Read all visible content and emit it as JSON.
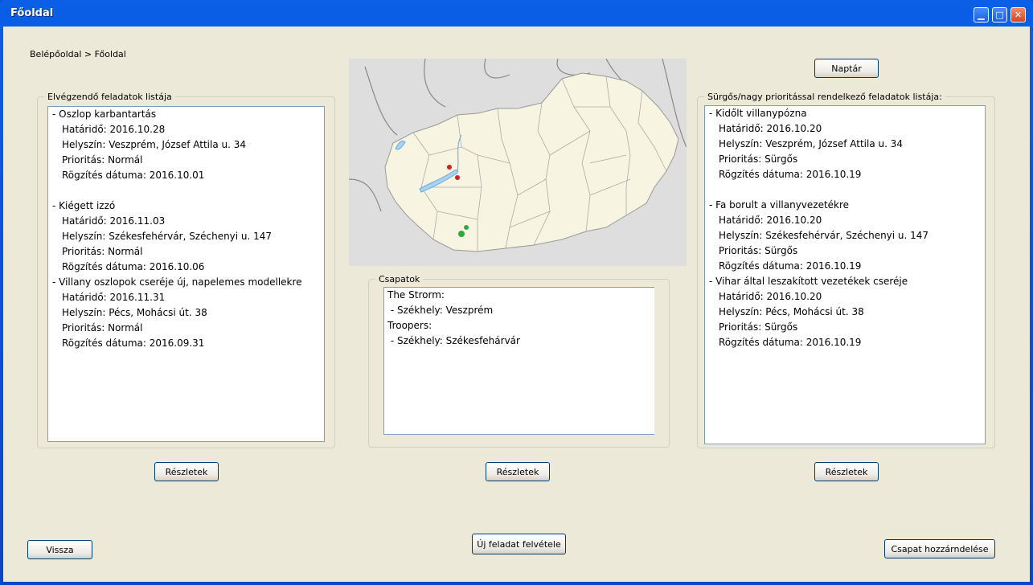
{
  "window": {
    "title": "Főoldal"
  },
  "breadcrumb": "Belépőoldal > Főoldal",
  "tasks_panel": {
    "legend": "Elvégzendő feladatok listája",
    "items": [
      {
        "title": "- Oszlop karbantartás",
        "deadline": "Határidő: 2016.10.28",
        "location": "Helyszín: Veszprém, József Attila u. 34",
        "priority": "Prioritás: Normál",
        "recorded": "Rögzítés dátuma: 2016.10.01"
      },
      {
        "title": "- Kiégett izzó",
        "deadline": "Határidő: 2016.11.03",
        "location": "Helyszín: Székesfehérvár, Széchenyi u. 147",
        "priority": "Prioritás: Normál",
        "recorded": "Rögzítés dátuma: 2016.10.06"
      },
      {
        "title": "- Villany oszlopok cseréje új, napelemes modellekre",
        "deadline": "Határidő: 2016.11.31",
        "location": "Helyszín: Pécs, Mohácsi út. 38",
        "priority": "Prioritás: Normál",
        "recorded": "Rögzítés dátuma: 2016.09.31"
      }
    ],
    "details_button": "Részletek"
  },
  "teams_panel": {
    "legend": "Csapatok",
    "lines": [
      "The Strorm:",
      " - Székhely: Veszprém",
      "Troopers:",
      " - Székhely: Székesfehárvár"
    ],
    "details_button": "Részletek"
  },
  "urgent_panel": {
    "legend": "Sürgős/nagy prioritással rendelkező feladatok listája:",
    "items": [
      {
        "title": "- Kidőlt villanypózna",
        "deadline": "Határidő: 2016.10.20",
        "location": "Helyszín: Veszprém, József Attila u. 34",
        "priority": "Prioritás: Sürgős",
        "recorded": "Rögzítés dátuma: 2016.10.19"
      },
      {
        "title": "- Fa borult a villanyvezetékre",
        "deadline": "Határidő: 2016.10.20",
        "location": "Helyszín: Székesfehérvár, Széchenyi u. 147",
        "priority": "Prioritás: Sürgős",
        "recorded": "Rögzítés dátuma: 2016.10.19"
      },
      {
        "title": "- Vihar által leszakított vezetékek cseréje",
        "deadline": "Határidő: 2016.10.20",
        "location": "Helyszín: Pécs, Mohácsi út. 38",
        "priority": "Prioritás: Sürgős",
        "recorded": "Rögzítés dátuma: 2016.10.19"
      }
    ],
    "details_button": "Részletek"
  },
  "buttons": {
    "calendar": "Naptár",
    "back": "Vissza",
    "new_task": "Új feladat felvétele",
    "assign_team": "Csapat hozzárndelése"
  },
  "map": {
    "markers": [
      {
        "color": "#d21f1f",
        "kind": "task"
      },
      {
        "color": "#d21f1f",
        "kind": "task"
      },
      {
        "color": "#2faa3c",
        "kind": "team"
      },
      {
        "color": "#2faa3c",
        "kind": "team"
      }
    ]
  }
}
